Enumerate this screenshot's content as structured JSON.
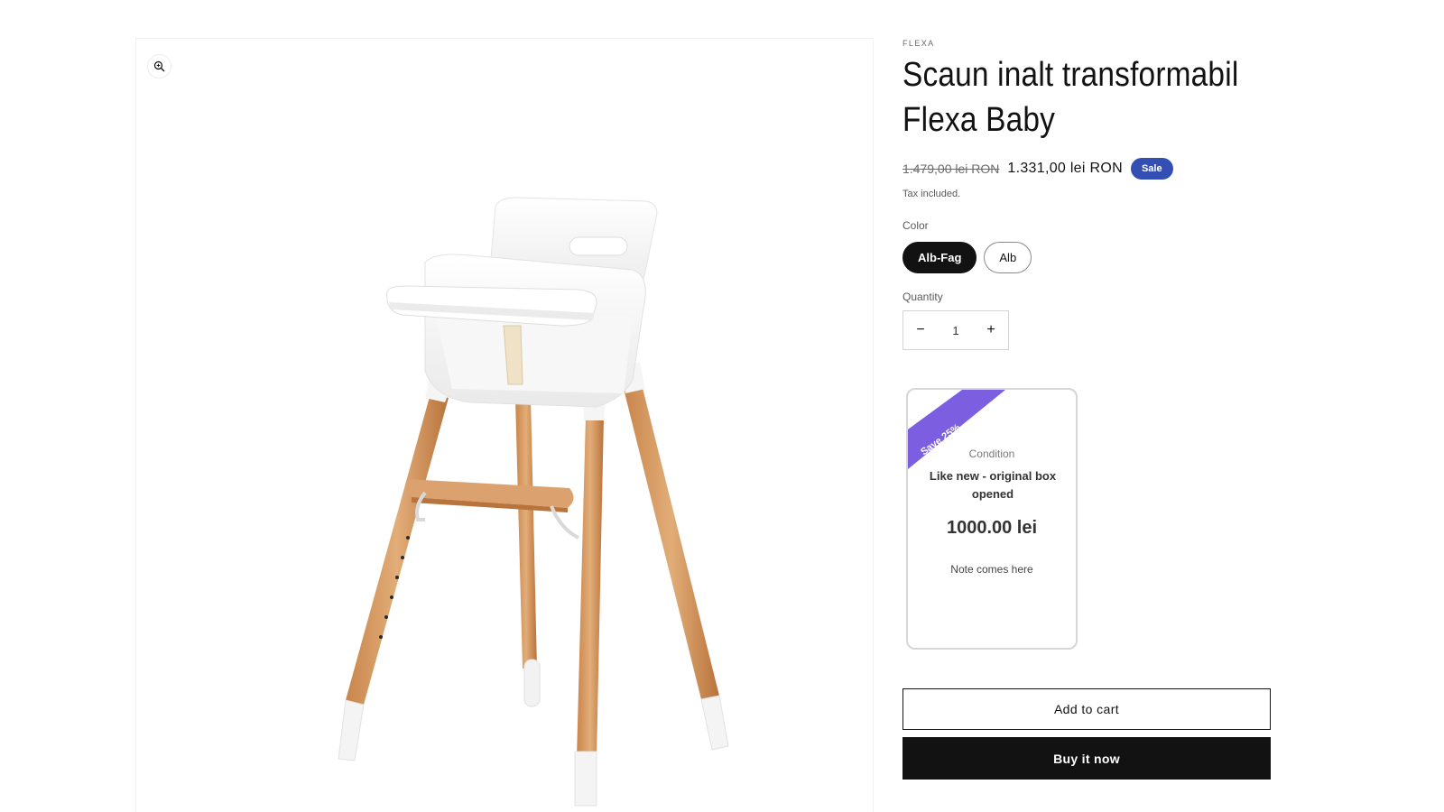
{
  "product": {
    "vendor": "FLEXA",
    "title": "Scaun inalt transformabil Flexa Baby",
    "price_old": "1.479,00 lei RON",
    "price_new": "1.331,00 lei RON",
    "sale_badge": "Sale",
    "tax_note": "Tax included."
  },
  "media": {
    "zoom_icon": "zoom-in-icon",
    "image_subject": "white highchair with beech wood legs"
  },
  "options": {
    "color_label": "Color",
    "colors": [
      {
        "label": "Alb-Fag",
        "selected": true
      },
      {
        "label": "Alb",
        "selected": false
      }
    ]
  },
  "quantity": {
    "label": "Quantity",
    "value": "1",
    "minus": "−",
    "plus": "+"
  },
  "offer_card": {
    "ribbon": "Save 25%",
    "condition_label": "Condition",
    "condition_value": "Like new - original box opened",
    "price": "1000.00 lei",
    "note": "Note comes here",
    "ribbon_color": "#7b5fe0"
  },
  "actions": {
    "add_to_cart": "Add to cart",
    "buy_now": "Buy it now"
  },
  "colors": {
    "sale_badge": "#334fb4",
    "primary": "#121212"
  }
}
